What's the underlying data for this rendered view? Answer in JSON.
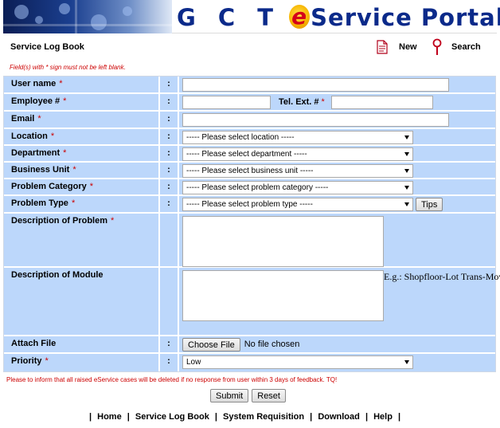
{
  "banner": {
    "title_gct": "G C T",
    "title_e": "e",
    "title_rest": "Service Portal"
  },
  "page": {
    "title": "Service Log Book",
    "required_notice": "Field(s) with * sign must not be left blank."
  },
  "top_actions": {
    "new_label": "New",
    "search_label": "Search"
  },
  "form": {
    "required_mark": "*",
    "colon": ":",
    "user_name": {
      "label": "User name",
      "value": ""
    },
    "employee_no": {
      "label": "Employee #",
      "value": ""
    },
    "tel_ext": {
      "label": "Tel. Ext. #",
      "value": ""
    },
    "email": {
      "label": "Email",
      "value": ""
    },
    "location": {
      "label": "Location",
      "selected": "----- Please select location -----"
    },
    "department": {
      "label": "Department",
      "selected": "----- Please select department -----"
    },
    "business_unit": {
      "label": "Business Unit",
      "selected": "----- Please select business unit -----"
    },
    "problem_category": {
      "label": "Problem Category",
      "selected": "----- Please select problem category -----"
    },
    "problem_type": {
      "label": "Problem Type",
      "selected": "----- Please select problem type -----",
      "tips_label": "Tips"
    },
    "description_problem": {
      "label": "Description of Problem",
      "value": ""
    },
    "description_module": {
      "label": "Description of Module",
      "value": "",
      "example": "E.g.: Shopfloor-Lot Trans-Move Lot"
    },
    "attach_file": {
      "label": "Attach File",
      "button_label": "Choose File",
      "status": "No file chosen"
    },
    "priority": {
      "label": "Priority",
      "selected": "Low"
    }
  },
  "delete_notice": "Please to inform that all raised eService cases will be deleted if no response from user within 3 days of feedback. TQ!",
  "buttons": {
    "submit": "Submit",
    "reset": "Reset"
  },
  "footer_nav": {
    "separator": "|",
    "items": [
      "Home",
      "Service Log Book",
      "System Requisition",
      "Download",
      "Help"
    ]
  },
  "colors": {
    "form_row_bg": "#bcd7fb",
    "title_blue": "#0b2a8a",
    "required_red": "#cc0000"
  }
}
